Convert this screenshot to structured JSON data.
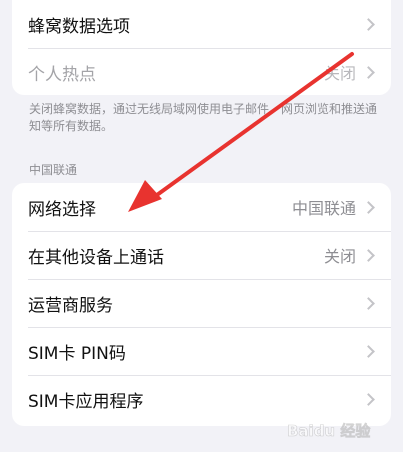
{
  "top_group": {
    "rows": [
      {
        "label": "蜂窝数据选项",
        "value": ""
      },
      {
        "label": "个人热点",
        "value": "关闭"
      }
    ]
  },
  "footnote": "关闭蜂窝数据，通过无线局域网使用电子邮件、网页浏览和推送通知等所有数据。",
  "carrier_section": {
    "header": "中国联通",
    "rows": [
      {
        "label": "网络选择",
        "value": "中国联通"
      },
      {
        "label": "在其他设备上通话",
        "value": "关闭"
      },
      {
        "label": "运营商服务",
        "value": ""
      },
      {
        "label": "SIM卡 PIN码",
        "value": ""
      },
      {
        "label": "SIM卡应用程序",
        "value": ""
      }
    ]
  },
  "annotation": {
    "arrow_color": "#e8332f"
  },
  "watermark": {
    "text": "Baidu 经验"
  }
}
